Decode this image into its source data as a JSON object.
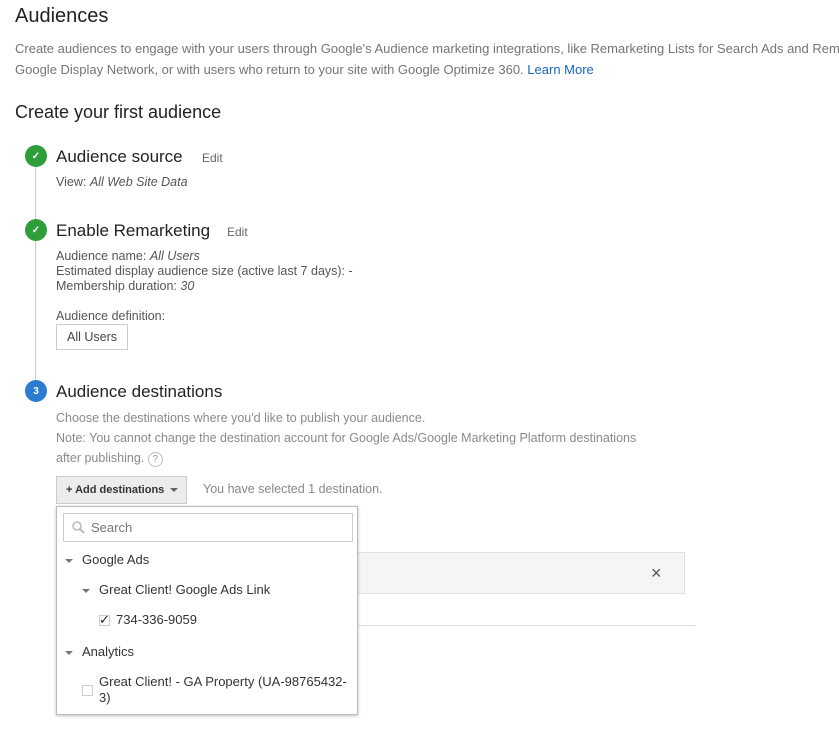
{
  "header": {
    "title": "Audiences",
    "description_line1": "Create audiences to engage with your users through Google's Audience marketing integrations, like Remarketing Lists for Search Ads and Rema",
    "description_line2": "Google Display Network, or with users who return to your site with Google Optimize 360.",
    "learn_more": "Learn More"
  },
  "section_title": "Create your first audience",
  "steps": [
    {
      "title": "Audience source",
      "edit": "Edit",
      "status": "complete",
      "view_label": "View:",
      "view_value": "All Web Site Data"
    },
    {
      "title": "Enable Remarketing",
      "edit": "Edit",
      "status": "complete",
      "name_label": "Audience name:",
      "name_value": "All Users",
      "size_label": "Estimated display audience size (active last 7 days): -",
      "duration_label": "Membership duration:",
      "duration_value": "30",
      "definition_label": "Audience definition:",
      "definition_chip": "All Users"
    },
    {
      "number": "3",
      "title": "Audience destinations",
      "status": "active",
      "choose_text": "Choose the destinations where you'd like to publish your audience.",
      "note_line1": "Note: You cannot change the destination account for Google Ads/Google Marketing Platform destinations",
      "note_line2": "after publishing.",
      "help_icon": "?",
      "add_button": "+ Add destinations",
      "selected_text": "You have selected 1 destination."
    }
  ],
  "dropdown": {
    "search_placeholder": "Search",
    "groups": [
      {
        "label": "Google Ads",
        "subgroup": "Great Client! Google Ads Link",
        "account": "734-336-9059",
        "checked": true
      },
      {
        "label": "Analytics",
        "property_line1": "Great Client! - GA Property (UA-98765432-",
        "property_line2": "3)",
        "checked": false
      }
    ]
  },
  "close_icon": "×",
  "colors": {
    "complete": "#2e9e3a",
    "active": "#2a7cd0",
    "link": "#1565c0"
  }
}
